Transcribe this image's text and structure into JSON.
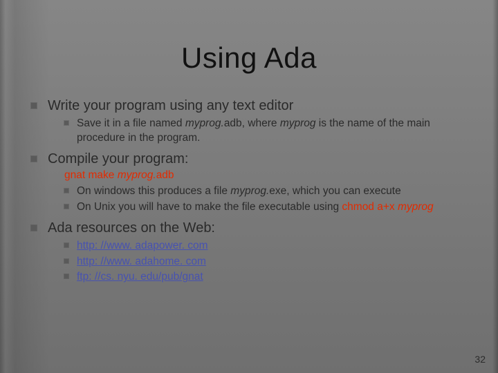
{
  "slide": {
    "title": "Using Ada",
    "page_number": "32"
  },
  "points": {
    "write": {
      "heading": "Write your program using any text editor",
      "sub": {
        "t1": "Save it in a file named ",
        "fn1": "myprog.",
        "t2": "adb, where ",
        "fn2": "myprog",
        "t3": " is the name of the main procedure in the program."
      }
    },
    "compile": {
      "heading": "Compile your program:",
      "cmd": {
        "c1": "gnat make ",
        "c2": "myprog.",
        "c3": "adb"
      },
      "sub1": {
        "t1": "On windows this produces a file ",
        "fn": "myprog.",
        "t2": "exe, which you can execute"
      },
      "sub2": {
        "t1": "On Unix you will have to make the file executable using ",
        "c1": "chmod a+x ",
        "c2": "myprog"
      }
    },
    "resources": {
      "heading": "Ada resources on the Web:",
      "links": {
        "l1": "http: //www. adapower. com",
        "l2": "http: //www. adahome. com",
        "l3": "ftp: //cs. nyu. edu/pub/gnat"
      }
    }
  }
}
